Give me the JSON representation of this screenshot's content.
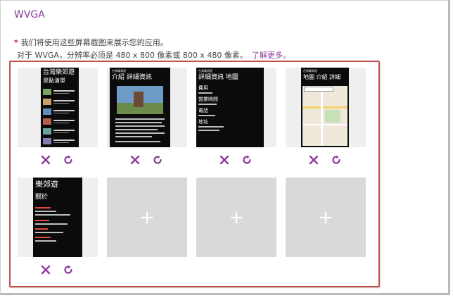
{
  "section": {
    "title": "WVGA"
  },
  "requirements": {
    "star": "*",
    "line1": "我们将使用这些屏幕截图来展示您的应用。",
    "line2": "对于 WVGA，分辨率必须是 480 x 800 像素或 800 x 480 像素。",
    "link": "了解更多。"
  },
  "screenshots": [
    {
      "title": "台灣樂郊遊",
      "subtitle": "景點清單",
      "kind": "list"
    },
    {
      "title": "介紹 詳細資訊",
      "header": "台灣樂郊遊",
      "kind": "photo"
    },
    {
      "title": "詳細資訊 地圖",
      "header": "台灣樂郊遊",
      "kind": "details",
      "labels": [
        "費用",
        "營業時間",
        "電話",
        "地址"
      ]
    },
    {
      "title": "地圖 介紹 詳細",
      "header": "台灣樂郊遊",
      "kind": "map"
    },
    {
      "title": "樂郊遊",
      "subtitle": "關於",
      "kind": "about"
    }
  ],
  "empty_slots": [
    "+",
    "+",
    "+"
  ],
  "colors": {
    "accent": "#8b3a9a",
    "frame": "#c0504d",
    "empty": "#d9d9d9"
  },
  "icons": {
    "remove": "close-icon",
    "replace": "refresh-icon",
    "add": "plus-icon"
  }
}
